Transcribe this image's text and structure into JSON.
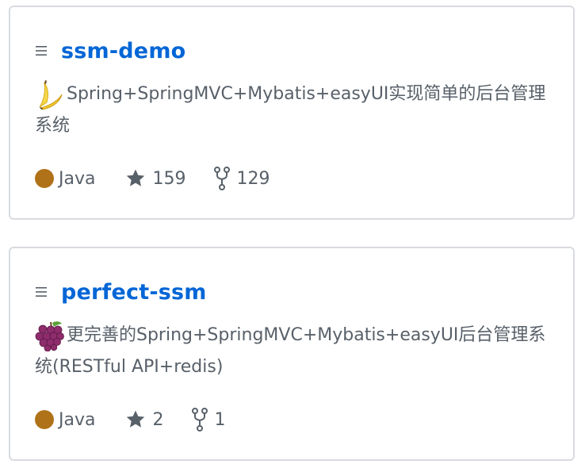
{
  "repos": [
    {
      "name": "ssm-demo",
      "emoji": "banana",
      "description": "Spring+SpringMVC+Mybatis+easyUI实现简单的后台管理系统",
      "language": "Java",
      "language_color": "#b07219",
      "stars": "159",
      "forks": "129"
    },
    {
      "name": "perfect-ssm",
      "emoji": "grapes",
      "description": "更完善的Spring+SpringMVC+Mybatis+easyUI后台管理系统(RESTful API+redis)",
      "language": "Java",
      "language_color": "#b07219",
      "stars": "2",
      "forks": "1"
    }
  ],
  "icons": {
    "repo": "list-icon",
    "star": "star-icon",
    "fork": "fork-icon"
  },
  "colors": {
    "link": "#0366d6",
    "muted": "#586069",
    "border": "#d8dbdf"
  }
}
